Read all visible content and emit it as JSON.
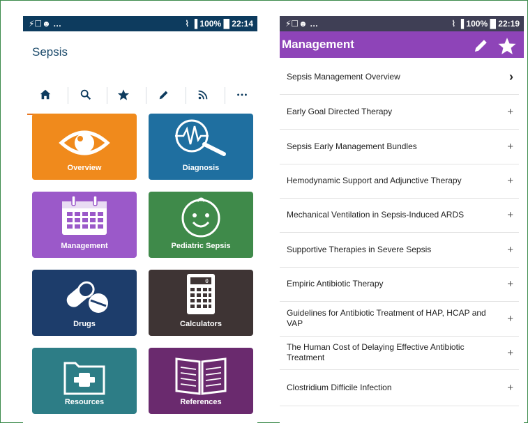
{
  "left_phone": {
    "status": {
      "left_icons": "⚡☐☻ …",
      "right": "⌇ ▐ 100% █ 22:14"
    },
    "app_title": "Sepsis",
    "tabs": [
      "home-icon",
      "search-icon",
      "star-icon",
      "pencil-icon",
      "rss-icon",
      "more-icon"
    ],
    "tiles": [
      {
        "label": "Overview",
        "color": "#f08a1c",
        "icon": "eye-icon"
      },
      {
        "label": "Diagnosis",
        "color": "#1f6fa0",
        "icon": "ecg-magnifier-icon"
      },
      {
        "label": "Management",
        "color": "#9b59c9",
        "icon": "calendar-icon"
      },
      {
        "label": "Pediatric Sepsis",
        "color": "#3f8a4a",
        "icon": "baby-face-icon"
      },
      {
        "label": "Drugs",
        "color": "#1d3d6b",
        "icon": "pills-icon"
      },
      {
        "label": "Calculators",
        "color": "#3e3434",
        "icon": "calculator-icon"
      },
      {
        "label": "Resources",
        "color": "#2d7d86",
        "icon": "first-aid-folder-icon"
      },
      {
        "label": "References",
        "color": "#6a2a6e",
        "icon": "open-book-icon"
      }
    ]
  },
  "right_phone": {
    "status": {
      "left_icons": "⚡☐☻ …",
      "right": "⌇ ▐ 100% █ 22:19"
    },
    "appbar_title": "Management",
    "items": [
      {
        "label": "Sepsis Management Overview",
        "icon": "›"
      },
      {
        "label": "Early Goal Directed Therapy",
        "icon": "+"
      },
      {
        "label": "Sepsis Early Management Bundles",
        "icon": "+"
      },
      {
        "label": "Hemodynamic Support and Adjunctive Therapy",
        "icon": "+"
      },
      {
        "label": "Mechanical Ventilation in Sepsis-Induced ARDS",
        "icon": "+"
      },
      {
        "label": "Supportive Therapies in Severe Sepsis",
        "icon": "+"
      },
      {
        "label": "Empiric Antibiotic Therapy",
        "icon": "+"
      },
      {
        "label": "Guidelines for Antibiotic Treatment of HAP, HCAP and VAP",
        "icon": "+"
      },
      {
        "label": "The Human Cost of Delaying Effective Antibiotic Treatment",
        "icon": "+"
      },
      {
        "label": "Clostridium Difficile Infection",
        "icon": "+"
      }
    ]
  }
}
